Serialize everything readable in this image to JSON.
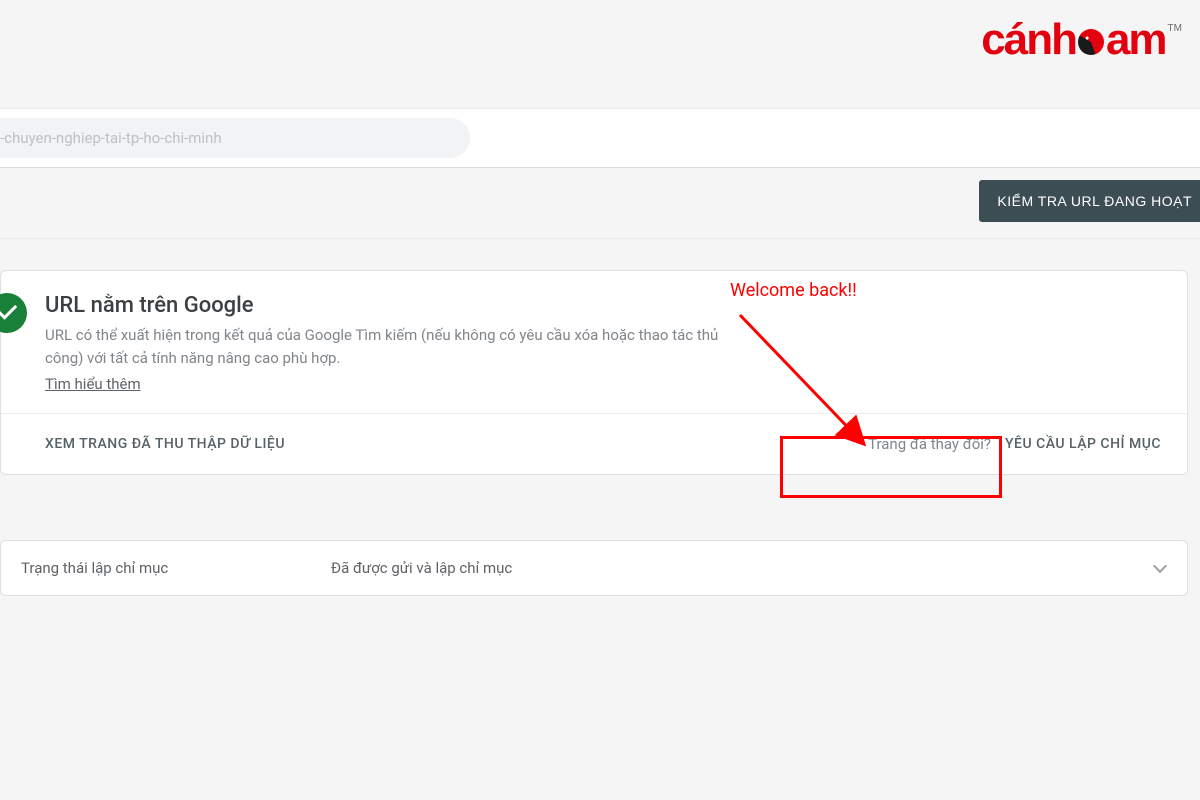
{
  "logo": {
    "text_left": "cánh",
    "text_right": "am",
    "tm": "TM"
  },
  "url_bar": {
    "fragment": "-chuyen-nghiep-tai-tp-ho-chi-minh"
  },
  "buttons": {
    "test_live": "KIỂM TRA URL ĐANG HOẠT",
    "view_crawled": "XEM TRANG ĐÃ THU THẬP DỮ LIỆU",
    "request_indexing": "YÊU CẦU LẬP CHỈ MỤC"
  },
  "status": {
    "heading": "URL nằm trên Google",
    "description": "URL có thể xuất hiện trong kết quả của Google Tìm kiếm (nếu không có yêu cầu xóa hoặc thao tác thủ công) với tất cả tính năng nâng cao phù hợp.",
    "learn_more": "Tìm hiểu thêm",
    "page_changed": "Trang đã thay đổi?"
  },
  "coverage": {
    "label": "Trạng thái lập chỉ mục",
    "value": "Đã được gửi và lập chỉ mục"
  },
  "annotation": {
    "text": "Welcome back!!"
  },
  "colors": {
    "accent_red": "#e3000f",
    "success": "#188038",
    "dark_btn": "#3c4d54",
    "highlight": "#ff0000"
  }
}
